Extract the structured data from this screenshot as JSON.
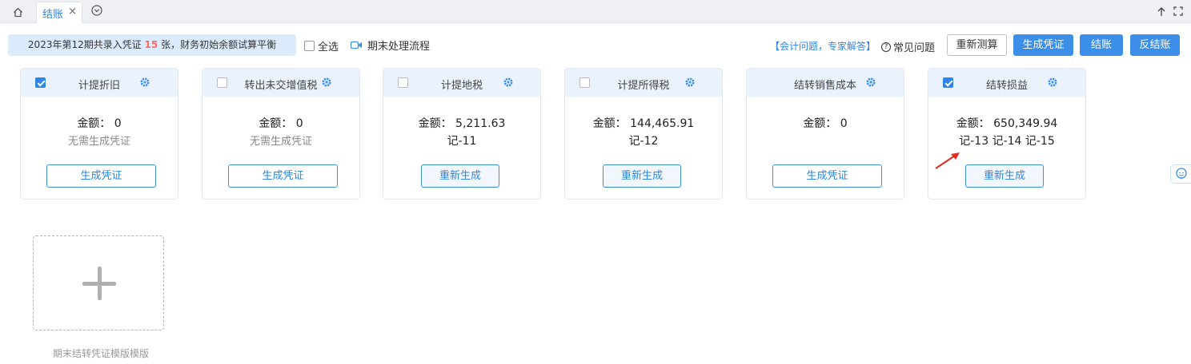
{
  "tabs": {
    "active_label": "结账",
    "close": "×"
  },
  "toolbar": {
    "summary_prefix": "2023年第12期共录入凭证 ",
    "summary_count": "15",
    "summary_suffix": " 张，财务初始余额试算平衡",
    "select_all": "全选",
    "process": "期末处理流程",
    "expert": "【会计问题，专家解答】",
    "faq": "常见问题",
    "faq_icon": "?",
    "recalc": "重新测算",
    "gen_voucher": "生成凭证",
    "close_period": "结账",
    "reverse_close": "反结账"
  },
  "cards": [
    {
      "title": "计提折旧",
      "checked": true,
      "amount": "金额： 0",
      "sub": "无需生成凭证",
      "button": "生成凭证"
    },
    {
      "title": "转出未交增值税",
      "checked": false,
      "amount": "金额： 0",
      "sub": "无需生成凭证",
      "button": "生成凭证"
    },
    {
      "title": "计提地税",
      "checked": false,
      "amount": "金额： 5,211.63",
      "sub": "记-11",
      "button": "重新生成"
    },
    {
      "title": "计提所得税",
      "checked": false,
      "amount": "金额： 144,465.91",
      "sub": "记-12",
      "button": "重新生成"
    },
    {
      "title": "结转销售成本",
      "checked": false,
      "amount": "金额： 0",
      "sub": "",
      "button": "生成凭证"
    },
    {
      "title": "结转损益",
      "checked": true,
      "amount": "金额： 650,349.94",
      "sub": "记-13 记-14 记-15",
      "button": "重新生成"
    }
  ],
  "add_template": {
    "label": "期末结转凭证模版模版"
  },
  "colors": {
    "accent": "#3b8fe8",
    "card_head": "#eaf3fd",
    "count_red": "#f56c6c",
    "arrow_red": "#e02b20"
  }
}
